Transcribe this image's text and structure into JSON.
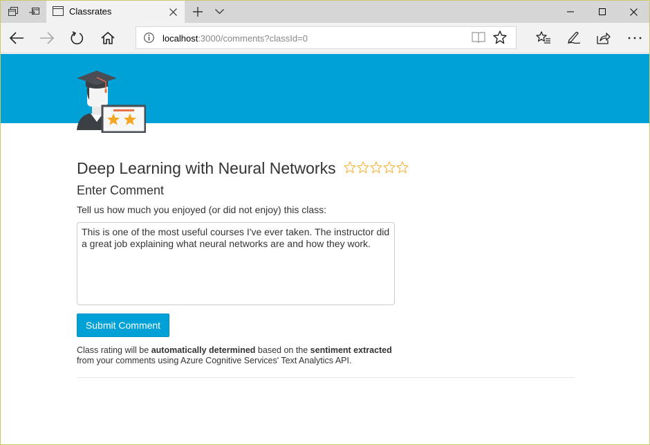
{
  "browser": {
    "tab_title": "Classrates",
    "url_host": "localhost",
    "url_rest": ":3000/comments?classId=0"
  },
  "icons": {
    "tab_manager": "tab-manager-icon",
    "set_aside": "set-aside-tabs-icon",
    "tab_page": "page-icon",
    "close": "close-icon",
    "new_tab": "plus-icon",
    "tab_menu": "chevron-down-icon",
    "minimize": "minimize-icon",
    "maximize": "maximize-icon",
    "window_close": "close-icon",
    "back": "back-arrow-icon",
    "forward": "forward-arrow-icon",
    "refresh": "refresh-icon",
    "home": "home-icon",
    "info": "info-icon",
    "reading_view": "book-icon",
    "favorite": "star-icon",
    "favorites_hub": "favorites-list-icon",
    "web_note": "pen-icon",
    "share": "share-icon",
    "more": "more-icon"
  },
  "page": {
    "class_title": "Deep Learning with Neural Networks",
    "rating_stars": 0,
    "rating_max": 5,
    "comment_heading": "Enter Comment",
    "prompt": "Tell us how much you enjoyed (or did not enjoy) this class:",
    "comment_value": "This is one of the most useful courses I've ever taken. The instructor did a great job explaining what neural networks are and how they work.",
    "submit_label": "Submit Comment",
    "note_part1": "Class rating will be ",
    "note_bold1": "automatically determined",
    "note_part2": " based on the ",
    "note_bold2": "sentiment extracted",
    "note_part3": "from your comments using Azure Cognitive Services' Text Analytics API."
  },
  "colors": {
    "banner": "#00a1d6",
    "button": "#00a1d6",
    "star_outline": "#f5b33a"
  }
}
